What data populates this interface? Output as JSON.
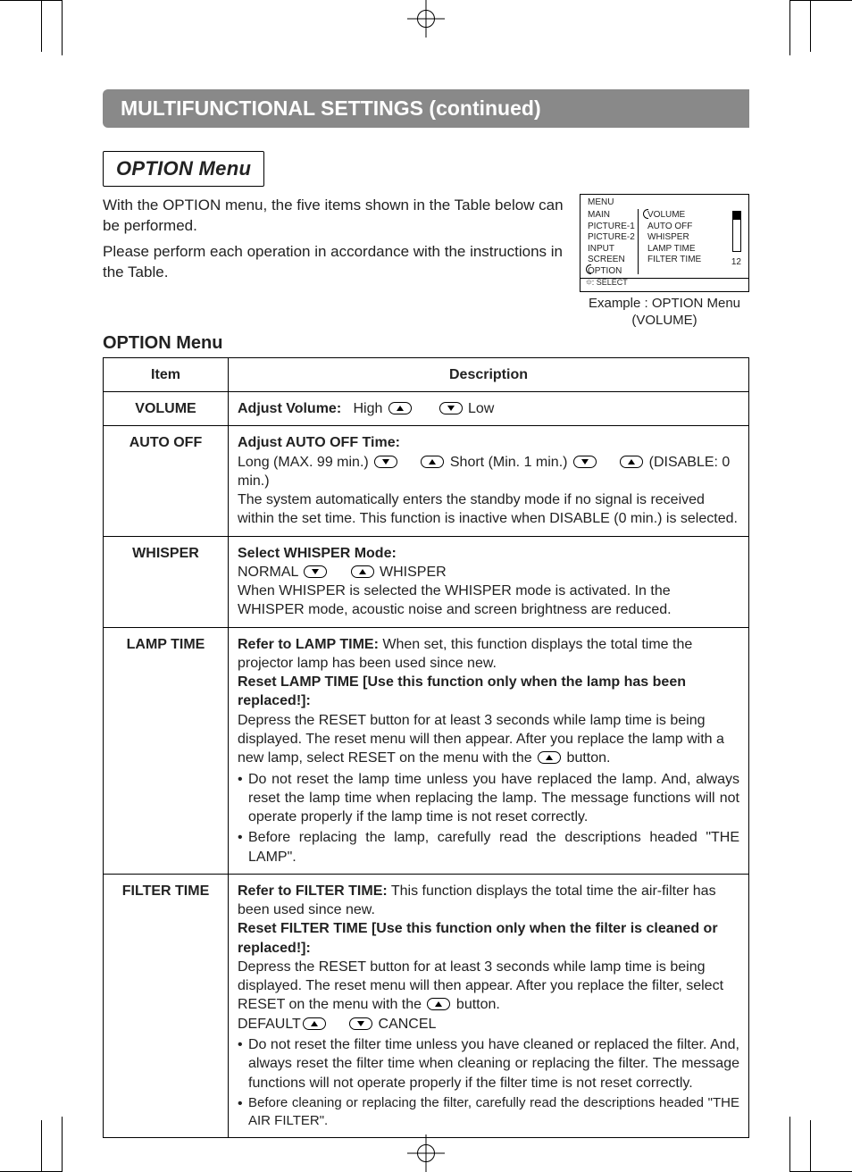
{
  "banner": "MULTIFUNCTIONAL SETTINGS (continued)",
  "menu_box": "OPTION Menu",
  "intro_1": "With the OPTION menu, the five items shown in the Table below can be performed.",
  "intro_2": "Please perform each operation in accordance with the instructions in the Table.",
  "fig": {
    "title": "MENU",
    "left_items": [
      "MAIN",
      "PICTURE-1",
      "PICTURE-2",
      "INPUT",
      "SCREEN",
      "OPTION"
    ],
    "right_items": [
      "VOLUME",
      "AUTO OFF",
      "WHISPER",
      "LAMP TIME",
      "FILTER TIME"
    ],
    "value": "12",
    "footer": "⯐: SELECT",
    "caption_1": "Example : OPTION Menu",
    "caption_2": "(VOLUME)"
  },
  "table_title": "OPTION Menu",
  "headers": {
    "item": "Item",
    "desc": "Description"
  },
  "rows": {
    "volume": {
      "item": "VOLUME",
      "lead": "Adjust Volume:",
      "high": "High",
      "low": "Low"
    },
    "autooff": {
      "item": "AUTO OFF",
      "lead": "Adjust AUTO OFF Time:",
      "long": "Long (MAX. 99 min.)",
      "short": "Short (Min. 1 min.)",
      "disable": "(DISABLE: 0 min.)",
      "note": "The system automatically enters the standby mode if no signal is received within the set time. This function is inactive when DISABLE (0 min.) is selected."
    },
    "whisper": {
      "item": "WHISPER",
      "lead": "Select WHISPER Mode:",
      "normal": "NORMAL",
      "whisper": "WHISPER",
      "note": "When WHISPER is selected  the WHISPER mode is activated. In the WHISPER mode, acoustic noise and screen brightness are reduced."
    },
    "lamp": {
      "item": "LAMP TIME",
      "p1a": "Refer to LAMP TIME:",
      "p1b": "When set, this function displays the total time the projector lamp has been used since new.",
      "p2a": "Reset LAMP TIME  [Use this function only when the lamp has been replaced!]:",
      "p2b_a": "Depress the RESET button for at least 3 seconds while lamp time is being displayed. The reset menu will then appear. After you replace the lamp with a new lamp, select RESET on the menu with the ",
      "p2b_b": " button.",
      "b1": "Do not reset the lamp time unless you have replaced the lamp. And, always reset the lamp time when replacing the lamp. The message functions will not operate properly if the lamp time is not reset correctly.",
      "b2": "Before replacing the lamp, carefully read the descriptions headed \"THE LAMP\"."
    },
    "filter": {
      "item": "FILTER TIME",
      "p1a": "Refer to FILTER TIME:",
      "p1b": "This function displays the total time the air-filter has been used since new.",
      "p2a": "Reset FILTER TIME [Use this function only when the filter is cleaned or replaced!]:",
      "p2b_a": "Depress the RESET button for at least 3 seconds while lamp time is being displayed. The reset menu will then appear. After you replace the filter, select RESET on the menu with the ",
      "p2b_b": " button.",
      "default": "DEFAULT",
      "cancel": "CANCEL",
      "b1": "Do not reset the filter time unless you have cleaned or replaced the filter. And, always reset the filter time when cleaning or replacing the filter. The message functions will not operate properly if the filter time is not reset correctly.",
      "b2": "Before cleaning or replacing the filter, carefully read the descriptions headed \"THE AIR FILTER\"."
    }
  }
}
